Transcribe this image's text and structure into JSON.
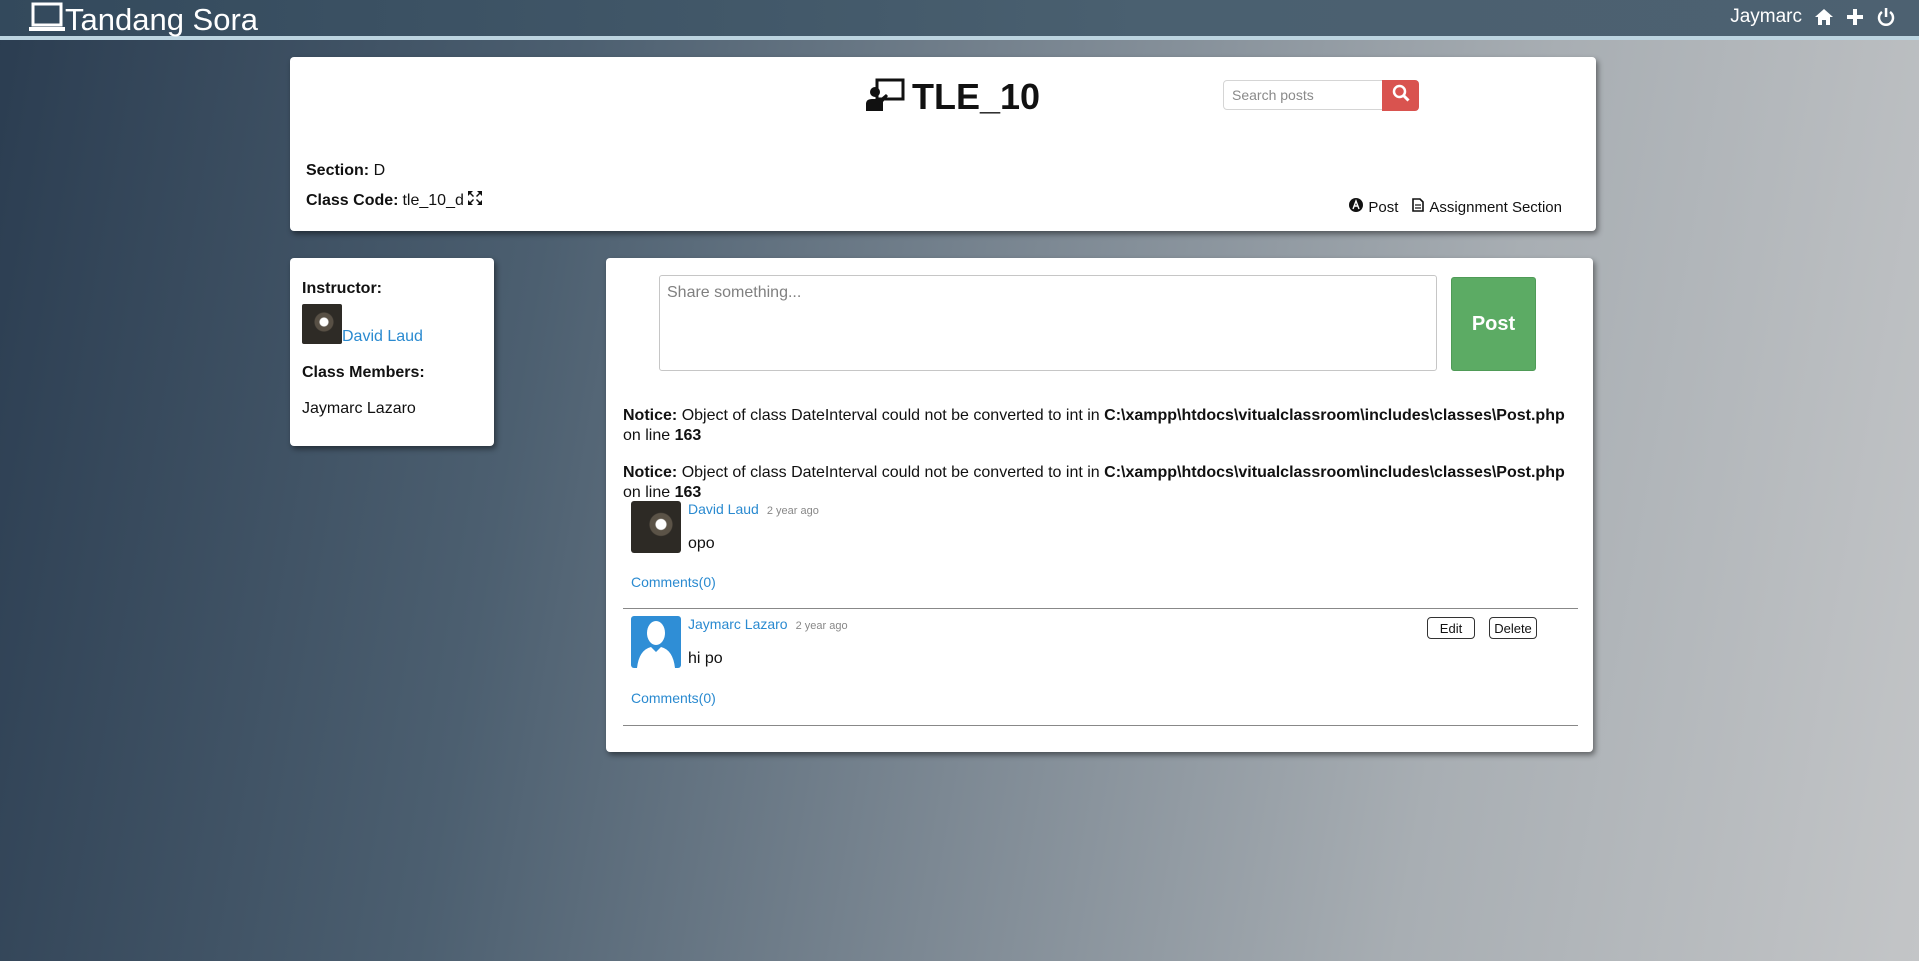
{
  "app": {
    "brand": "Tandang Sora",
    "user_name": "Jaymarc"
  },
  "class": {
    "title": "TLE_10",
    "section_label": "Section:",
    "section_value": "D",
    "code_label": "Class Code:",
    "code_value": "tle_10_d"
  },
  "search": {
    "placeholder": "Search posts"
  },
  "header_links": {
    "post": "Post",
    "assignment": "Assignment Section"
  },
  "sidebar": {
    "instructor_label": "Instructor:",
    "instructor_name": "David Laud",
    "members_label": "Class Members:",
    "members": [
      "Jaymarc Lazaro"
    ]
  },
  "composer": {
    "placeholder": "Share something...",
    "post_label": "Post"
  },
  "notices": [
    {
      "label": "Notice:",
      "text": "Object of class DateInterval could not be converted to int in",
      "path": "C:\\xampp\\htdocs\\vitualclassroom\\includes\\classes\\Post.php",
      "suffix": "on line",
      "line": "163"
    },
    {
      "label": "Notice:",
      "text": "Object of class DateInterval could not be converted to int in",
      "path": "C:\\xampp\\htdocs\\vitualclassroom\\includes\\classes\\Post.php",
      "suffix": "on line",
      "line": "163"
    }
  ],
  "posts": [
    {
      "author": "David Laud",
      "time": "2 year ago",
      "body": "opo",
      "comments": "Comments(0)"
    },
    {
      "author": "Jaymarc Lazaro",
      "time": "2 year ago",
      "body": "hi po",
      "comments": "Comments(0)",
      "edit_label": "Edit",
      "delete_label": "Delete"
    }
  ],
  "colors": {
    "accent_link": "#2a8ad0",
    "post_button": "#5cab64",
    "search_button": "#d9534f"
  }
}
